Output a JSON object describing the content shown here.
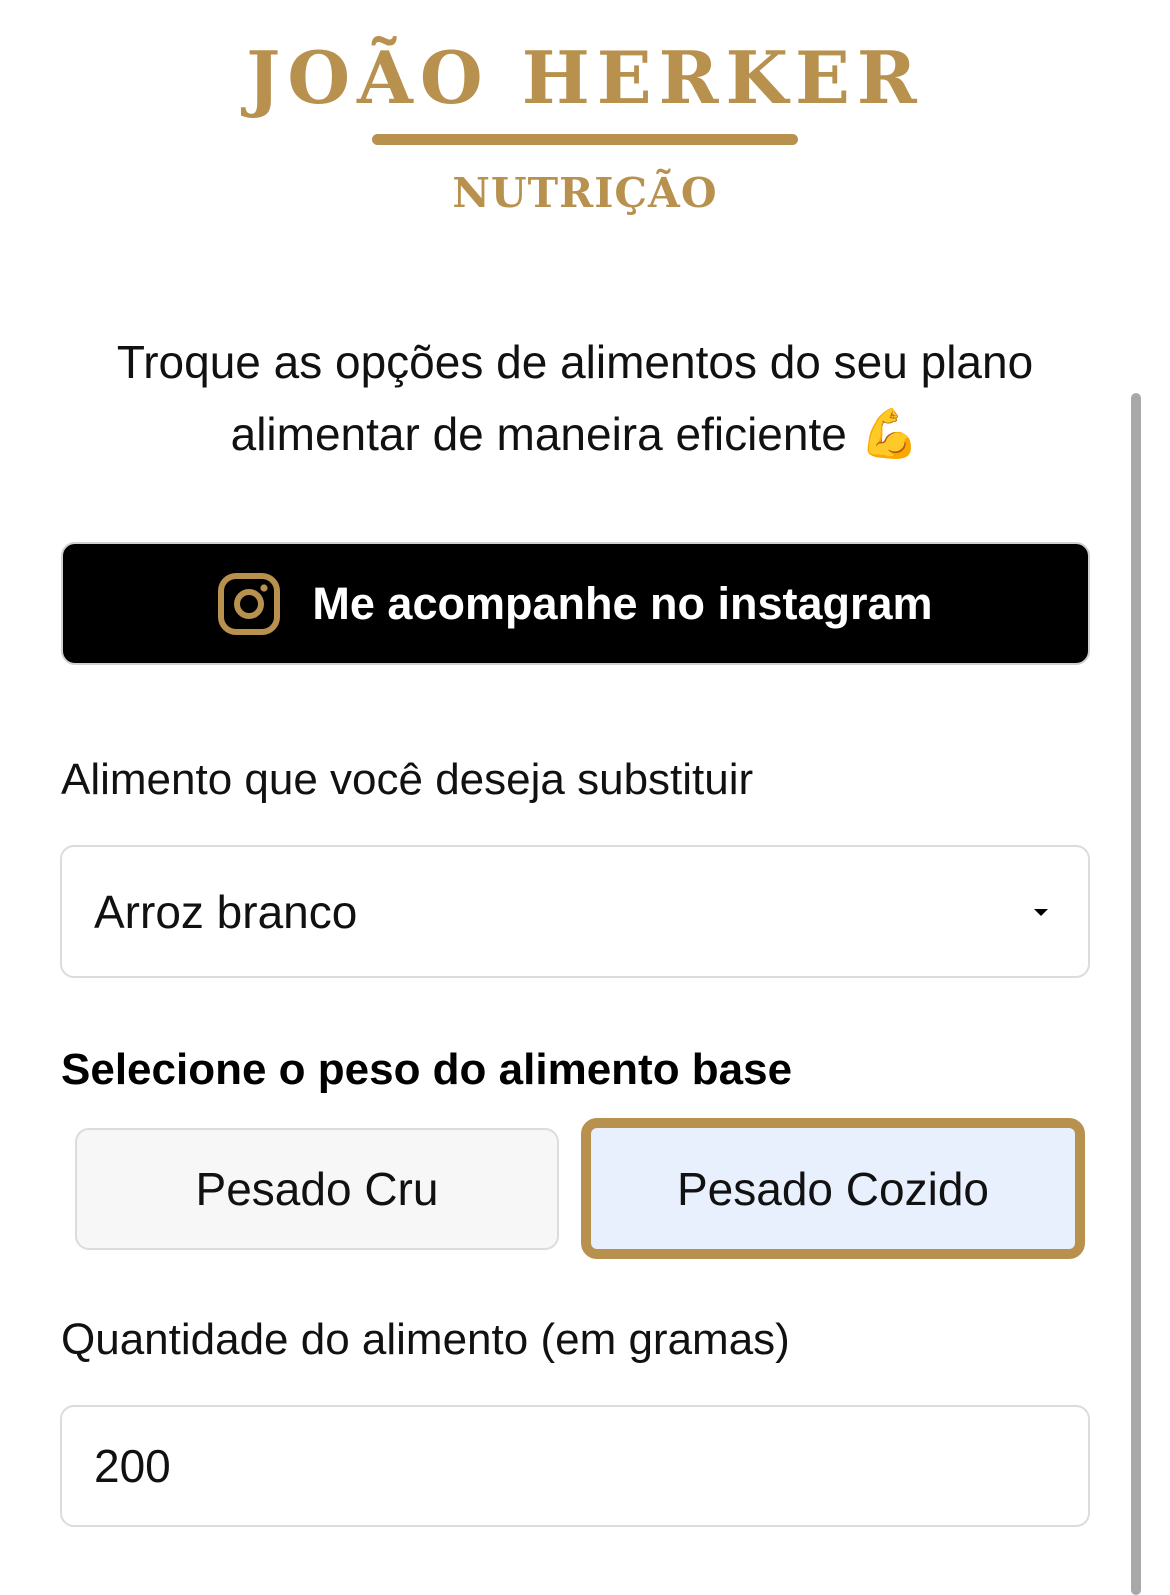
{
  "logo": {
    "name": "JOÃO HERKER",
    "subtitle": "NUTRIÇÃO",
    "color": "#b8914f"
  },
  "tagline": {
    "line1": "Troque as opções de alimentos do seu plano",
    "line2": "alimentar de maneira eficiente",
    "emoji": "💪"
  },
  "instagram_button": {
    "label": "Me acompanhe no instagram",
    "icon": "instagram-icon"
  },
  "food_field": {
    "label": "Alimento que você deseja substituir",
    "selected": "Arroz branco"
  },
  "weight_section": {
    "title": "Selecione o peso do alimento base",
    "options": [
      "Pesado Cru",
      "Pesado Cozido"
    ],
    "selected": "Pesado Cozido"
  },
  "quantity_field": {
    "label": "Quantidade do alimento (em gramas)",
    "value": "200"
  },
  "colors": {
    "accent": "#b8914f",
    "selected_bg": "#e9f0fd",
    "button_bg": "#000000"
  }
}
